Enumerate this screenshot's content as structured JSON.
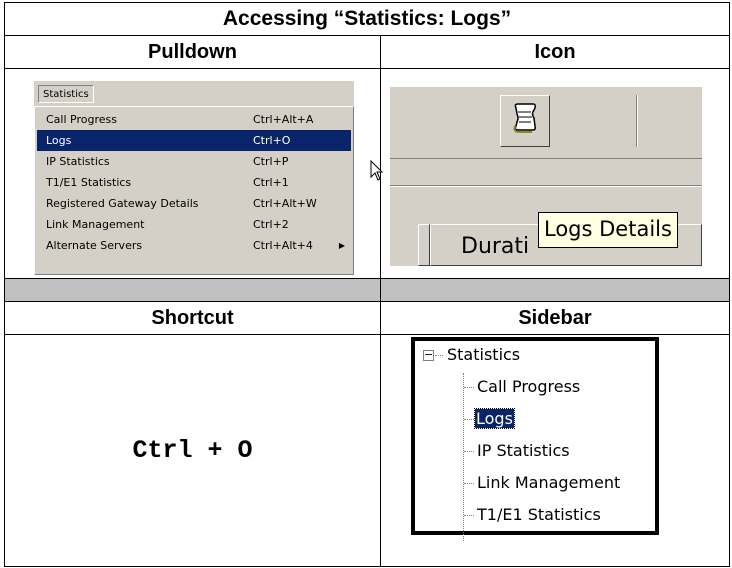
{
  "title": "Accessing “Statistics: Logs”",
  "headers": {
    "pulldown": "Pulldown",
    "icon": "Icon",
    "shortcut": "Shortcut",
    "sidebar": "Sidebar"
  },
  "pulldown": {
    "menu_title": "Statistics",
    "items": [
      {
        "label": "Call Progress",
        "shortcut": "Ctrl+Alt+A",
        "selected": false
      },
      {
        "label": "Logs",
        "shortcut": "Ctrl+O",
        "selected": true
      },
      {
        "label": "IP Statistics",
        "shortcut": "Ctrl+P",
        "selected": false
      },
      {
        "label": "T1/E1 Statistics",
        "shortcut": "Ctrl+1",
        "selected": false
      },
      {
        "label": "Registered Gateway Details",
        "shortcut": "Ctrl+Alt+W",
        "selected": false
      },
      {
        "label": "Link Management",
        "shortcut": "Ctrl+2",
        "selected": false
      },
      {
        "label": "Alternate Servers",
        "shortcut": "Ctrl+Alt+4",
        "selected": false,
        "submenu": true
      }
    ]
  },
  "icon": {
    "tooltip": "Logs Details",
    "column_label": "Durati",
    "icon_name": "logs-scroll-icon"
  },
  "shortcut": {
    "keys": "Ctrl + O"
  },
  "sidebar": {
    "root": "Statistics",
    "expander": "−",
    "items": [
      {
        "label": "Call Progress",
        "selected": false
      },
      {
        "label": "Logs",
        "selected": true
      },
      {
        "label": "IP Statistics",
        "selected": false
      },
      {
        "label": "Link Management",
        "selected": false
      },
      {
        "label": "T1/E1 Statistics",
        "selected": false
      }
    ]
  },
  "colors": {
    "menu_bg": "#d4d0c8",
    "selection": "#0a246a",
    "tooltip_bg": "#ffffe1",
    "separator_row": "#c0c0c0"
  }
}
